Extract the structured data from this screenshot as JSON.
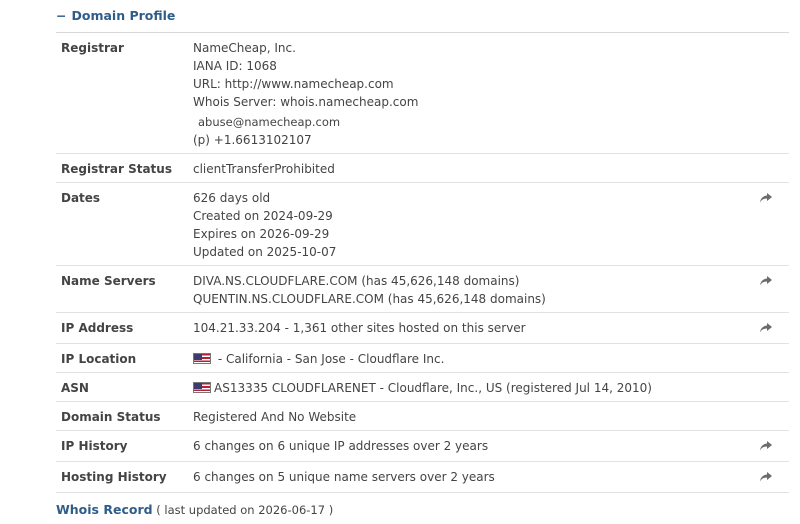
{
  "section": {
    "minus_glyph": "−",
    "title": "Domain Profile"
  },
  "rows": {
    "registrar": {
      "label": "Registrar",
      "name": "NameCheap, Inc.",
      "iana": "IANA ID: 1068",
      "url": "URL: http://www.namecheap.com",
      "whois": "Whois Server: whois.namecheap.com",
      "email": "abuse@namecheap.com",
      "phone": "(p) +1.6613102107"
    },
    "registrar_status": {
      "label": "Registrar Status",
      "value": "clientTransferProhibited"
    },
    "dates": {
      "label": "Dates",
      "age": "626 days old",
      "created": "Created on 2024-09-29",
      "expires": "Expires on 2026-09-29",
      "updated": "Updated on 2025-10-07"
    },
    "name_servers": {
      "label": "Name Servers",
      "ns1": "DIVA.NS.CLOUDFLARE.COM (has 45,626,148 domains)",
      "ns2": "QUENTIN.NS.CLOUDFLARE.COM (has 45,626,148 domains)"
    },
    "ip_address": {
      "label": "IP Address",
      "value": "104.21.33.204 - 1,361 other sites hosted on this server"
    },
    "ip_location": {
      "label": "IP Location",
      "value": " - California - San Jose - Cloudflare Inc."
    },
    "asn": {
      "label": "ASN",
      "value": "AS13335 CLOUDFLARENET - Cloudflare, Inc., US (registered Jul 14, 2010)"
    },
    "domain_status": {
      "label": "Domain Status",
      "value": "Registered And No Website"
    },
    "ip_history": {
      "label": "IP History",
      "value": "6 changes on 6 unique IP addresses over 2 years"
    },
    "hosting_history": {
      "label": "Hosting History",
      "value": "6 changes on 5 unique name servers over 2 years"
    }
  },
  "footer": {
    "link": "Whois Record",
    "updated": " ( last updated on 2026-06-17 )"
  },
  "icons": {
    "share": "share-arrow-icon",
    "flag": "us-flag-icon"
  },
  "colors": {
    "accent": "#2f5d8a",
    "text": "#444444",
    "border": "#e2e2e2"
  }
}
